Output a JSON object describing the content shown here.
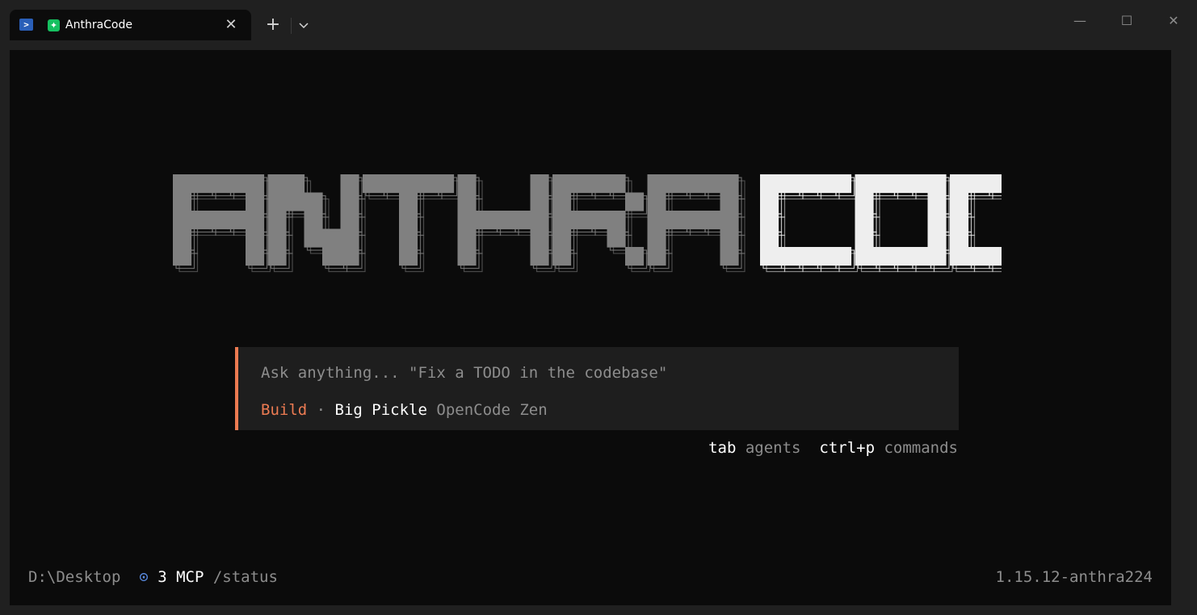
{
  "window": {
    "tab_title": "AnthraCode",
    "close_glyph": "✕",
    "new_tab_glyph": "+",
    "minimize_glyph": "—",
    "maximize_glyph": "☐",
    "window_close_glyph": "✕"
  },
  "logo": {
    "word_dim": "ANTHRA",
    "word_bright": "CODE",
    "dim_color": "#808080",
    "bright_color": "#eeeeee"
  },
  "prompt": {
    "placeholder": "Ask anything... \"Fix a TODO in the codebase\"",
    "agent": "Build",
    "separator": " · ",
    "model": "Big Pickle",
    "provider": "OpenCode Zen",
    "accent_color": "#ec7b52"
  },
  "hints": [
    {
      "key": "tab",
      "label": "agents"
    },
    {
      "key": "ctrl+p",
      "label": "commands"
    }
  ],
  "footer": {
    "cwd": "D:\\Desktop",
    "mcp_icon": "⊙",
    "mcp_count": "3 MCP",
    "mcp_command": "/status",
    "version": "1.15.12-anthra224"
  }
}
